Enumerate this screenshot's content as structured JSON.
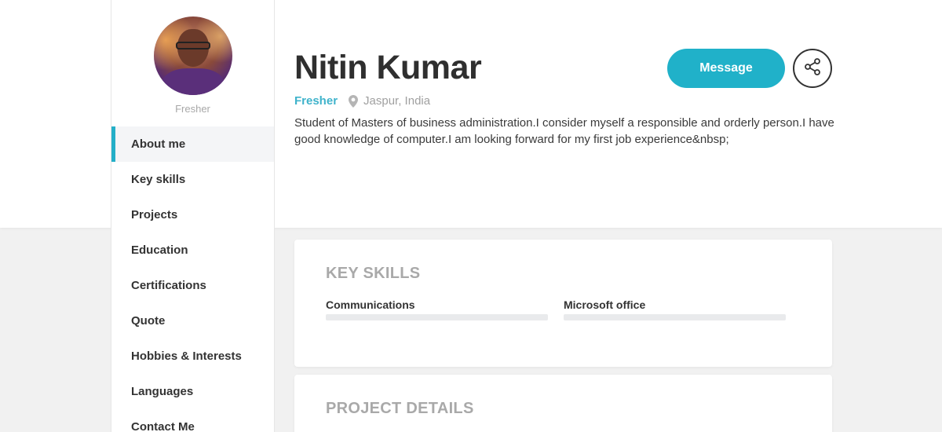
{
  "profile": {
    "role_caption": "Fresher",
    "name": "Nitin Kumar",
    "status": "Fresher",
    "location": "Jaspur, India",
    "about": "Student of Masters of business administration.I consider myself a responsible and orderly person.I have good knowledge of computer.I am looking forward for my first job experience&nbsp;"
  },
  "actions": {
    "message_label": "Message",
    "share_icon": "share-icon"
  },
  "sidebar": {
    "items": [
      {
        "label": "About me",
        "active": true
      },
      {
        "label": "Key skills",
        "active": false
      },
      {
        "label": "Projects",
        "active": false
      },
      {
        "label": "Education",
        "active": false
      },
      {
        "label": "Certifications",
        "active": false
      },
      {
        "label": "Quote",
        "active": false
      },
      {
        "label": "Hobbies & Interests",
        "active": false
      },
      {
        "label": "Languages",
        "active": false
      },
      {
        "label": "Contact Me",
        "active": false
      }
    ]
  },
  "key_skills": {
    "title": "KEY SKILLS",
    "skills": [
      {
        "name": "Communications",
        "level": 0
      },
      {
        "name": "Microsoft office",
        "level": 0
      }
    ]
  },
  "project_details": {
    "title": "PROJECT DETAILS"
  },
  "colors": {
    "accent": "#20b1c9",
    "status": "#3fb3cb"
  }
}
